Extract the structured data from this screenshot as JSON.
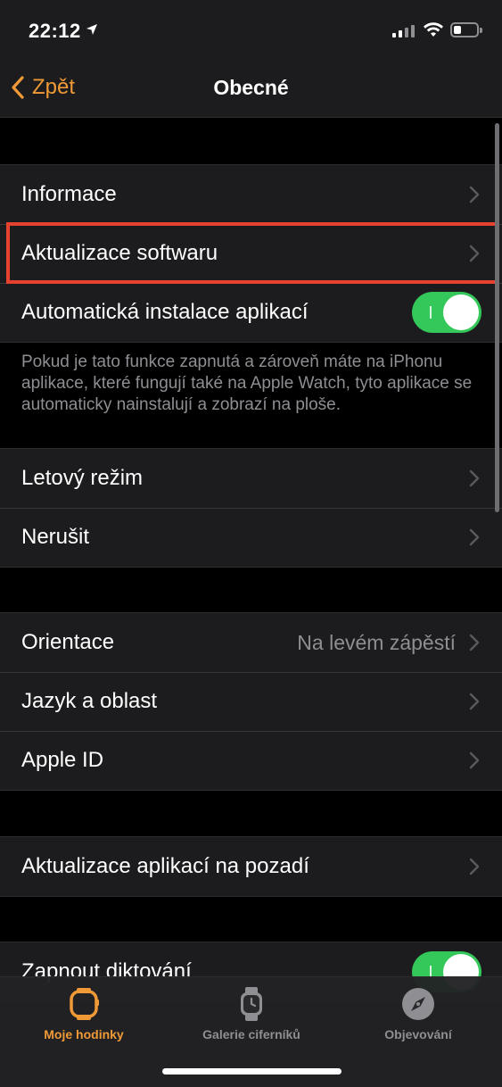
{
  "status": {
    "time": "22:12"
  },
  "nav": {
    "back_label": "Zpět",
    "title": "Obecné"
  },
  "section1": {
    "items": [
      {
        "label": "Informace"
      },
      {
        "label": "Aktualizace softwaru"
      },
      {
        "label": "Automatická instalace aplikací",
        "toggle": true
      }
    ],
    "footnote": "Pokud je tato funkce zapnutá a zároveň máte na iPhonu aplikace, které fungují také na Apple Watch, tyto aplikace se automaticky nainstalují a zobrazí na ploše."
  },
  "section2": {
    "items": [
      {
        "label": "Letový režim"
      },
      {
        "label": "Nerušit"
      }
    ]
  },
  "section3": {
    "items": [
      {
        "label": "Orientace",
        "value": "Na levém zápěstí"
      },
      {
        "label": "Jazyk a oblast"
      },
      {
        "label": "Apple ID"
      }
    ]
  },
  "section4": {
    "items": [
      {
        "label": "Aktualizace aplikací na pozadí"
      }
    ]
  },
  "section5": {
    "items": [
      {
        "label": "Zapnout diktování",
        "toggle": true
      }
    ]
  },
  "tabs": [
    {
      "label": "Moje hodinky",
      "icon": "watch-icon",
      "active": true
    },
    {
      "label": "Galerie ciferníků",
      "icon": "watch-face-gallery-icon",
      "active": false
    },
    {
      "label": "Objevování",
      "icon": "compass-icon",
      "active": false
    }
  ],
  "colors": {
    "accent": "#f09a37",
    "toggle_on": "#34c759",
    "highlight": "#e5432f",
    "background": "#000000",
    "cell": "#1c1c1e"
  }
}
